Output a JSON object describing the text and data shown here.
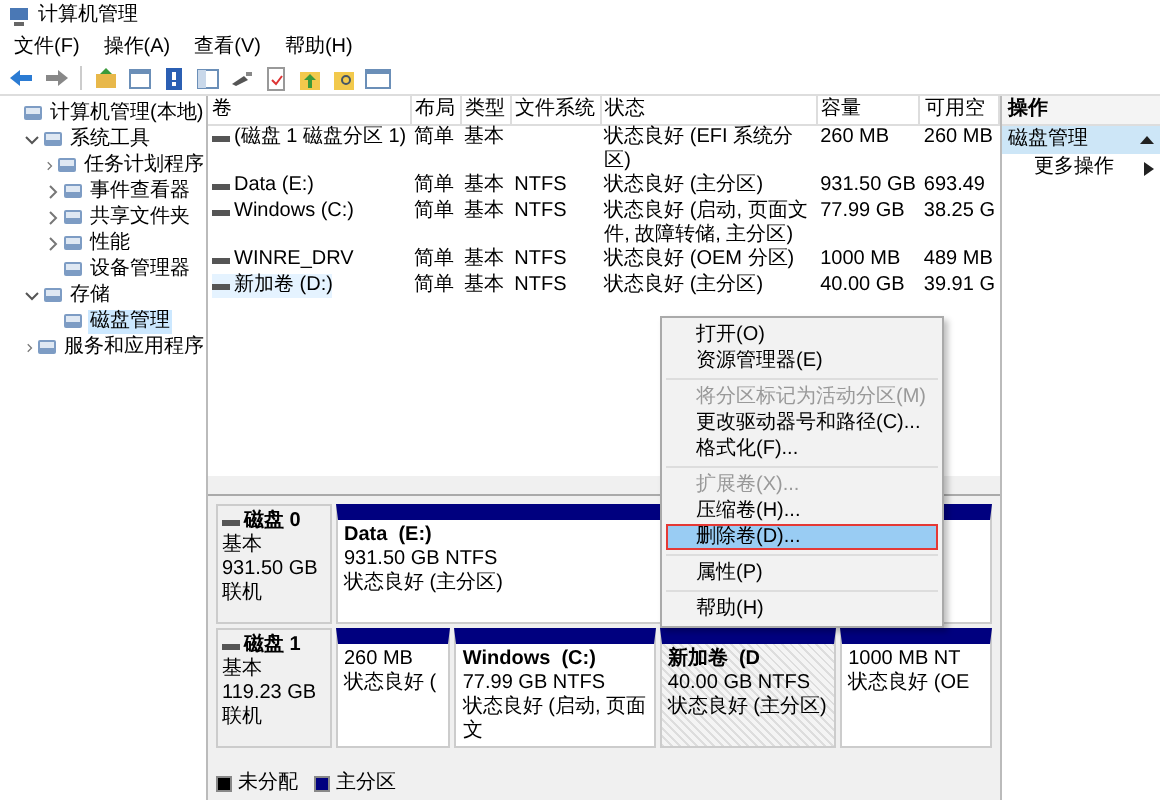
{
  "window": {
    "title": "计算机管理"
  },
  "menu_bar": [
    "文件(F)",
    "操作(A)",
    "查看(V)",
    "帮助(H)"
  ],
  "tree": [
    {
      "label": "计算机管理(本地)",
      "selected": false,
      "children": [
        {
          "label": "系统工具",
          "expanded": true,
          "selected": false,
          "children": [
            {
              "label": "任务计划程序",
              "expanded": false,
              "selected": false
            },
            {
              "label": "事件查看器",
              "expanded": false,
              "selected": false
            },
            {
              "label": "共享文件夹",
              "expanded": false,
              "selected": false
            },
            {
              "label": "性能",
              "expanded": false,
              "selected": false
            },
            {
              "label": "设备管理器",
              "selected": false
            }
          ]
        },
        {
          "label": "存储",
          "expanded": true,
          "selected": false,
          "children": [
            {
              "label": "磁盘管理",
              "selected": true
            }
          ]
        },
        {
          "label": "服务和应用程序",
          "expanded": false,
          "selected": false
        }
      ]
    }
  ],
  "table": {
    "columns": [
      "卷",
      "布局",
      "类型",
      "文件系统",
      "状态",
      "容量",
      "可用空"
    ],
    "rows": [
      {
        "volume": "(磁盘 1 磁盘分区 1)",
        "layout": "简单",
        "type": "基本",
        "status": "状态良好 (EFI 系统分区)",
        "capacity": "260 MB",
        "free": "260 MB",
        "selected": false
      },
      {
        "volume": "Data (E:)",
        "layout": "简单",
        "type": "基本",
        "file_system": "NTFS",
        "status": "状态良好 (主分区)",
        "capacity": "931.50 GB",
        "free": "693.49",
        "selected": false
      },
      {
        "volume": "Windows (C:)",
        "layout": "简单",
        "type": "基本",
        "file_system": "NTFS",
        "status": "状态良好 (启动, 页面文件, 故障转储, 主分区)",
        "capacity": "77.99 GB",
        "free": "38.25 G",
        "selected": false
      },
      {
        "volume": "WINRE_DRV",
        "layout": "简单",
        "type": "基本",
        "file_system": "NTFS",
        "status": "状态良好 (OEM 分区)",
        "capacity": "1000 MB",
        "free": "489 MB",
        "selected": false
      },
      {
        "volume": "新加卷 (D:)",
        "layout": "简单",
        "type": "基本",
        "file_system": "NTFS",
        "status": "状态良好 (主分区)",
        "capacity": "40.00 GB",
        "free": "39.91 G",
        "selected": true
      }
    ]
  },
  "disks": [
    {
      "name": "磁盘 0",
      "type": "基本",
      "size": "931.50 GB",
      "state": "联机",
      "partitions": [
        {
          "name": "Data  (E:)",
          "size": "931.50 GB NTFS",
          "status": "状态良好 (主分区)",
          "selected": false
        }
      ]
    },
    {
      "name": "磁盘 1",
      "type": "基本",
      "size": "119.23 GB",
      "state": "联机",
      "partitions": [
        {
          "size": "260 MB",
          "status": "状态良好 (",
          "selected": false
        },
        {
          "name": "Windows  (C:)",
          "size": "77.99 GB NTFS",
          "status": "状态良好 (启动, 页面文",
          "selected": false
        },
        {
          "name": "新加卷  (D",
          "size": "40.00 GB NTFS",
          "status": "状态良好 (主分区)",
          "selected": true
        },
        {
          "size": "1000 MB NT",
          "status": "状态良好 (OE",
          "selected": false
        }
      ]
    }
  ],
  "legend": [
    {
      "label": "未分配",
      "color": "#000000"
    },
    {
      "label": "主分区",
      "color": "#00007f"
    }
  ],
  "actions": {
    "title": "操作",
    "section": "磁盘管理",
    "items": [
      "更多操作"
    ]
  },
  "context_menu": [
    {
      "kind": "item",
      "label": "打开(O)",
      "disabled": false,
      "selected": false
    },
    {
      "kind": "item",
      "label": "资源管理器(E)",
      "disabled": false,
      "selected": false
    },
    {
      "kind": "separator"
    },
    {
      "kind": "item",
      "label": "将分区标记为活动分区(M)",
      "disabled": true,
      "selected": false
    },
    {
      "kind": "item",
      "label": "更改驱动器号和路径(C)...",
      "disabled": false,
      "selected": false
    },
    {
      "kind": "item",
      "label": "格式化(F)...",
      "disabled": false,
      "selected": false
    },
    {
      "kind": "separator"
    },
    {
      "kind": "item",
      "label": "扩展卷(X)...",
      "disabled": true,
      "selected": false
    },
    {
      "kind": "item",
      "label": "压缩卷(H)...",
      "disabled": false,
      "selected": false
    },
    {
      "kind": "item",
      "label": "删除卷(D)...",
      "disabled": false,
      "selected": true,
      "outlined": true
    },
    {
      "kind": "separator"
    },
    {
      "kind": "item",
      "label": "属性(P)",
      "disabled": false,
      "selected": false
    },
    {
      "kind": "separator"
    },
    {
      "kind": "item",
      "label": "帮助(H)",
      "disabled": false,
      "selected": false
    }
  ]
}
